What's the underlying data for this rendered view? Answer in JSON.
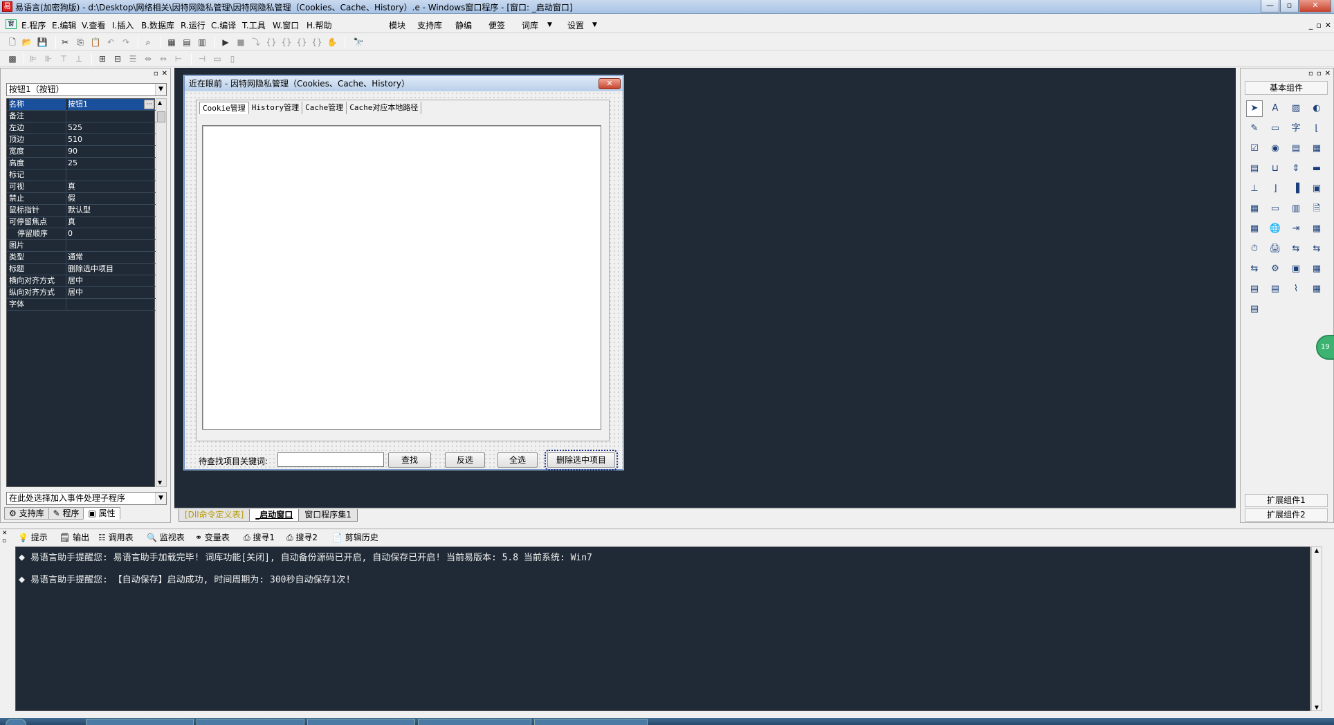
{
  "window": {
    "title": "易语言(加密狗版) - d:\\Desktop\\网络相关\\因特网隐私管理\\因特网隐私管理（Cookies、Cache、History）.e - Windows窗口程序 - [窗口: _启动窗口]",
    "icon": "app-icon"
  },
  "menu": {
    "items": [
      "E.程序",
      "E.编辑",
      "V.查看",
      "I.插入",
      "B.数据库",
      "R.运行",
      "C.编译",
      "T.工具",
      "W.窗口",
      "H.帮助"
    ],
    "right_items": [
      "模块",
      "支持库",
      "静编",
      "便签",
      "词库",
      "设置"
    ]
  },
  "property_panel": {
    "selector": "按钮1（按钮）",
    "rows": [
      {
        "k": "名称",
        "v": "按钮1"
      },
      {
        "k": "备注",
        "v": ""
      },
      {
        "k": "左边",
        "v": "525"
      },
      {
        "k": "顶边",
        "v": "510"
      },
      {
        "k": "宽度",
        "v": "90"
      },
      {
        "k": "高度",
        "v": "25"
      },
      {
        "k": "标记",
        "v": ""
      },
      {
        "k": "可视",
        "v": "真"
      },
      {
        "k": "禁止",
        "v": "假"
      },
      {
        "k": "鼠标指针",
        "v": "默认型"
      },
      {
        "k": "可停留焦点",
        "v": "真"
      },
      {
        "k": "停留顺序",
        "v": "0"
      },
      {
        "k": "图片",
        "v": ""
      },
      {
        "k": "类型",
        "v": "通常"
      },
      {
        "k": "标题",
        "v": "删除选中项目"
      },
      {
        "k": "横向对齐方式",
        "v": "居中"
      },
      {
        "k": "纵向对齐方式",
        "v": "居中"
      },
      {
        "k": "字体",
        "v": ""
      }
    ],
    "event_combo": "在此处选择加入事件处理子程序",
    "tabs": [
      "支持库",
      "程序",
      "属性"
    ]
  },
  "form": {
    "title": "近在眼前 - 因特网隐私管理（Cookies、Cache、History）",
    "tabs": [
      "Cookie管理",
      "History管理",
      "Cache管理",
      "Cache对应本地路径"
    ],
    "search_label": "待查找项目关键词:",
    "search_value": "",
    "buttons": {
      "find": "查找",
      "invert": "反选",
      "select_all": "全选",
      "delete": "删除选中项目"
    }
  },
  "doc_tabs": [
    "[Dll命令定义表]",
    "_启动窗口",
    "窗口程序集1"
  ],
  "components": {
    "header": "基本组件",
    "ext1": "扩展组件1",
    "ext2": "扩展组件2"
  },
  "badge": "19",
  "output": {
    "tabs": [
      "提示",
      "输出",
      "调用表",
      "监视表",
      "变量表",
      "搜寻1",
      "搜寻2",
      "剪辑历史"
    ],
    "lines": [
      "易语言助手提醒您:  易语言助手加载完毕!  词库功能[关闭], 自动备份源码已开启, 自动保存已开启!  当前易版本: 5.8  当前系统: Win7",
      "易语言助手提醒您: 【自动保存】启动成功, 时间周期为: 300秒自动保存1次!"
    ]
  }
}
